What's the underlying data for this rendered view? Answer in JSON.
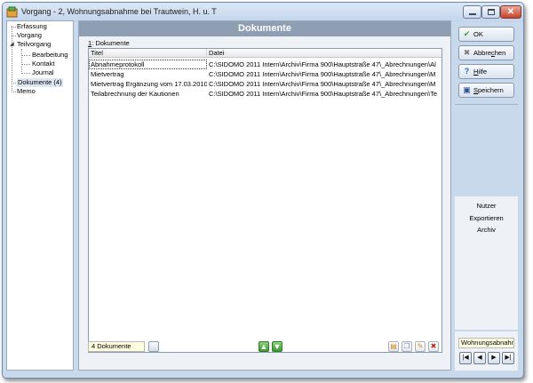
{
  "window": {
    "title": "Vorgang - 2, Wohnungsabnahme bei Trautwein, H. u. T",
    "close_glyph": "✕"
  },
  "tree": {
    "items": [
      {
        "label": "Erfassung"
      },
      {
        "label": "Vorgang"
      },
      {
        "label": "Teilvorgang",
        "expander": "◢"
      },
      {
        "label": "Bearbeitung"
      },
      {
        "label": "Kontakt"
      },
      {
        "label": "Journal"
      },
      {
        "label": "Dokumente (4)"
      },
      {
        "label": "Memo"
      }
    ]
  },
  "panel": {
    "title": "Dokumente",
    "tab_label_hotkey": "1",
    "tab_label_text": ": Dokumente",
    "columns": [
      "Titel",
      "Datei"
    ],
    "rows": [
      {
        "titel": "Abnahmeprotokoll",
        "datei": "C:\\SIDOMO 2011 Intern\\Archiv\\Firma 900\\Hauptstraße 47\\_Abrechnungen\\Al"
      },
      {
        "titel": "Mietvertrag",
        "datei": "C:\\SIDOMO 2011 Intern\\Archiv\\Firma 900\\Hauptstraße 47\\_Abrechnungen\\M"
      },
      {
        "titel": "Mietvertrag Ergänzung vom 17.03.2010",
        "datei": "C:\\SIDOMO 2011 Intern\\Archiv\\Firma 900\\Hauptstraße 47\\_Abrechnungen\\M"
      },
      {
        "titel": "Teilabrechnung der Kautionen",
        "datei": "C:\\SIDOMO 2011 Intern\\Archiv\\Firma 900\\Hauptstraße 47\\_Abrechnungen\\Te"
      }
    ],
    "status": "4 Dokumente",
    "move_up_glyph": "▲",
    "move_down_glyph": "▼",
    "tools": [
      {
        "name": "add-document-icon",
        "glyph": "▤",
        "color": "#c98a1c"
      },
      {
        "name": "copy-document-icon",
        "glyph": "❐",
        "color": "#7a8aa0"
      },
      {
        "name": "edit-document-icon",
        "glyph": "✎",
        "color": "#c98a1c"
      },
      {
        "name": "delete-document-icon",
        "glyph": "✖",
        "color": "#c0281f"
      }
    ]
  },
  "commands": {
    "ok": {
      "label": "OK",
      "glyph": "✔",
      "color": "#3a9a2a"
    },
    "cancel": {
      "hotkey_pre": "Abbre",
      "hotkey": "c",
      "hotkey_post": "hen",
      "glyph": "✖",
      "color": "#7b7b7b"
    },
    "help": {
      "hotkey": "H",
      "rest": "ilfe",
      "glyph": "?",
      "color": "#2e63b8"
    },
    "save": {
      "hotkey": "S",
      "rest": "peichern",
      "glyph": "▣",
      "color": "#2a4f95"
    }
  },
  "side_links": [
    "Nutzer",
    "Exportieren",
    "Archiv"
  ],
  "navigator": {
    "current": "Wohnungsabnahn",
    "first": "|◀",
    "prev": "◀",
    "next": "▶",
    "last": "▶|"
  }
}
